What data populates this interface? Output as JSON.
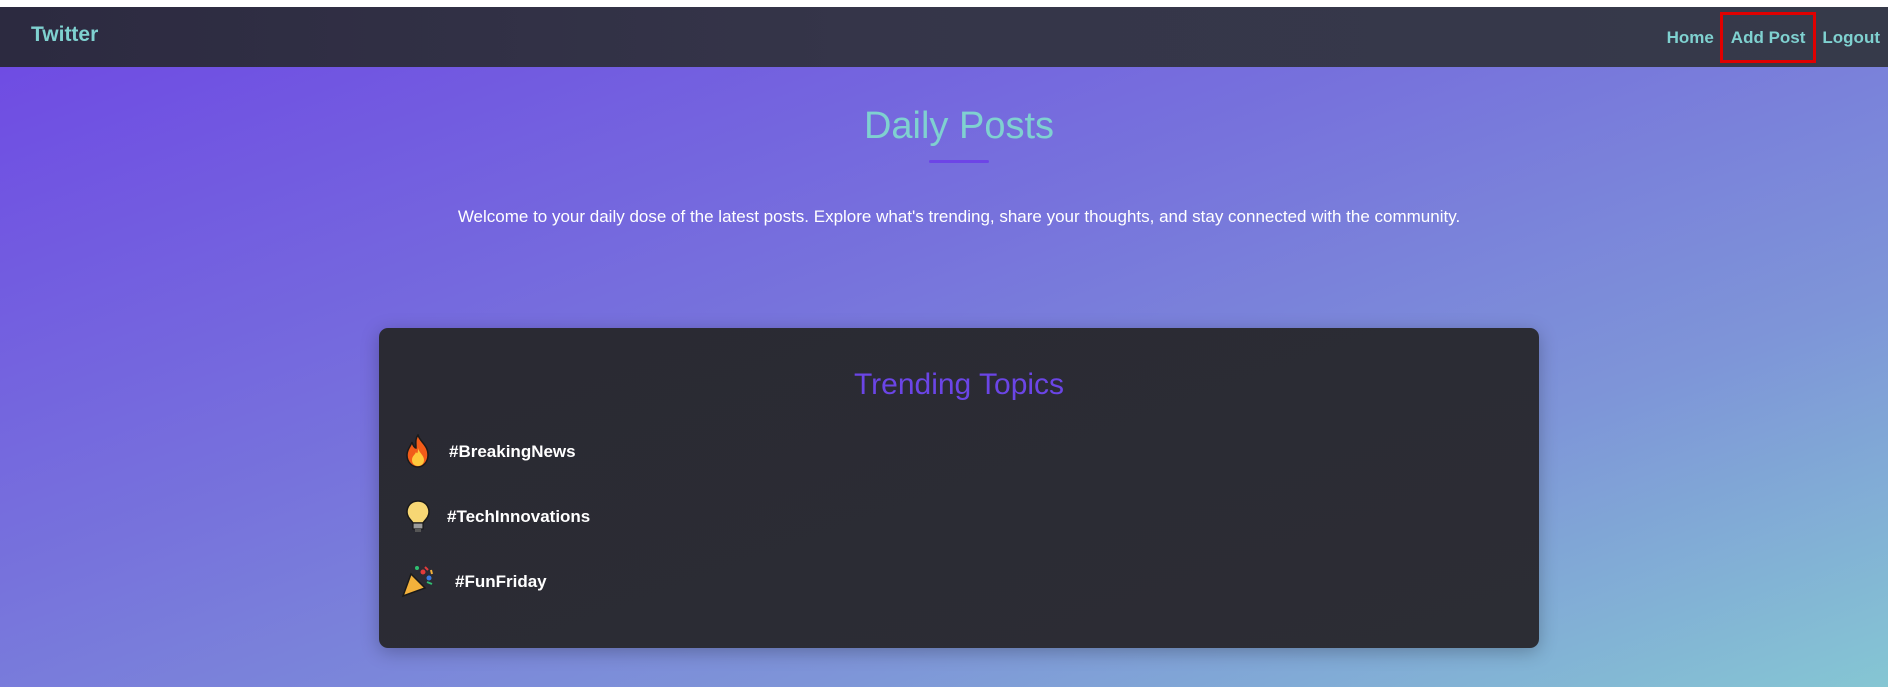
{
  "navbar": {
    "brand": "Twitter",
    "links": [
      {
        "label": "Home"
      },
      {
        "label": "Add Post"
      },
      {
        "label": "Logout"
      }
    ]
  },
  "header": {
    "title": "Daily Posts",
    "subtitle": "Welcome to your daily dose of the latest posts. Explore what's trending, share your thoughts, and stay connected with the community."
  },
  "trending": {
    "title": "Trending Topics",
    "topics": [
      {
        "icon": "fire-icon",
        "label": "#BreakingNews"
      },
      {
        "icon": "lightbulb-icon",
        "label": "#TechInnovations"
      },
      {
        "icon": "party-popper-icon",
        "label": "#FunFriday"
      }
    ]
  },
  "colors": {
    "accent_teal": "#7fd1d0",
    "accent_purple": "#6b45e6",
    "highlight_red": "#e00000",
    "card_bg": "#2b2c33"
  }
}
